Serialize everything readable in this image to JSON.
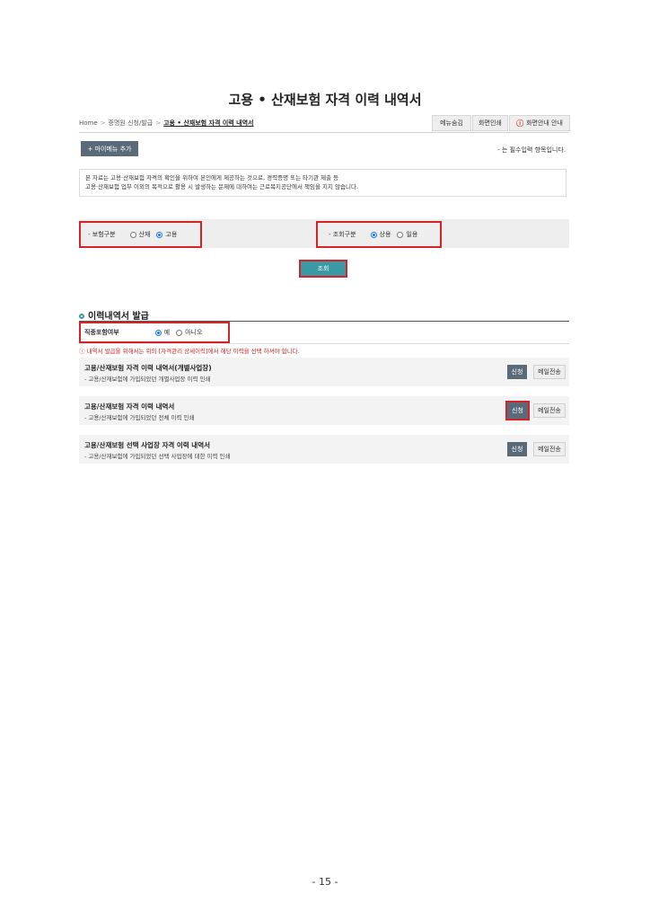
{
  "page": {
    "title": "고용 • 산재보험 자격 이력 내역서",
    "page_number": "- 15 -"
  },
  "breadcrumb": {
    "home": "Home",
    "sep": ">",
    "level1": "증명원 신청/발급",
    "current": "고용 • 산재보험 자격 이력 내역서"
  },
  "top_buttons": {
    "menu_search": "메뉴숨김",
    "print": "화면인쇄",
    "screen_guide": "화면안내 안내",
    "warn_glyph": "ⓘ"
  },
  "my_menu": {
    "label": "+ 마이메뉴 추가"
  },
  "required_note": "- 는 필수입력 항목입니다.",
  "notice": {
    "line1": "본 자료는 고용·산재보험 자격의 확인을 위하여 본인에게 제공하는 것으로, 경력증명 또는 타기관 제출 등",
    "line2": "고용·산재보험 업무 이외의 목적으로 활용 시 발생하는 문제에 대하여는 근로복지공단에서 책임을 지지 않습니다."
  },
  "filters": {
    "insurance_type": {
      "label": "- 보험구분",
      "options": [
        "산재",
        "고용"
      ],
      "selected": "고용"
    },
    "query_type": {
      "label": "- 조회구분",
      "options": [
        "상용",
        "일용"
      ],
      "selected": "상용"
    }
  },
  "search_button": "조회",
  "section": {
    "title": "이력내역서 발급",
    "job_include": {
      "label": "직종포함여부",
      "options": [
        "예",
        "아니오"
      ],
      "selected": "예"
    },
    "warning": "ⓘ 내역서 발급을 위해서는 위의 [자격관리 상세이력]에서 해당 이력을 선택 하셔야 합니다.",
    "items": [
      {
        "title": "고용/산재보험 자격 이력 내역서(개별사업장)",
        "desc": "- 고용/산재보험에 가입되었던 개별사업장 이력 인쇄",
        "apply": "신청",
        "mail": "메일전송"
      },
      {
        "title": "고용/산재보험 자격 이력 내역서",
        "desc": "- 고용/산재보험에 가입되었던 전체 이력 인쇄",
        "apply": "신청",
        "mail": "메일전송"
      },
      {
        "title": "고용/산재보험 선택 사업장 자격 이력 내역서",
        "desc": "- 고용/산재보험에 가입되었던 선택 사업장에 대한 이력 인쇄",
        "apply": "신청",
        "mail": "메일전송"
      }
    ]
  },
  "colors": {
    "accent": "#3a9aa4",
    "highlight": "#d5232a",
    "button_dark": "#5a6a78"
  }
}
